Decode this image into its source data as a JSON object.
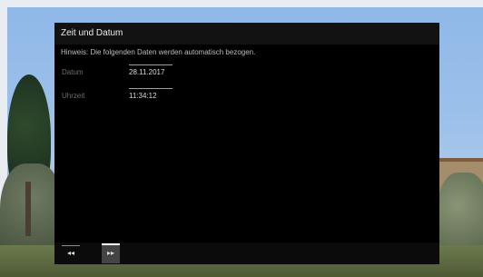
{
  "dialog": {
    "title": "Zeit und Datum",
    "hint": "Hinweis: Die folgenden Daten werden automatisch bezogen.",
    "fields": [
      {
        "label": "Datum",
        "value": "28.11.2017"
      },
      {
        "label": "Uhrzeit",
        "value": "11:34:12"
      }
    ]
  },
  "footer": {
    "prev_icon": "rewind-icon",
    "prev_symbol": "◂◂",
    "next_icon": "fast-forward-icon",
    "next_symbol": "▸▸"
  }
}
